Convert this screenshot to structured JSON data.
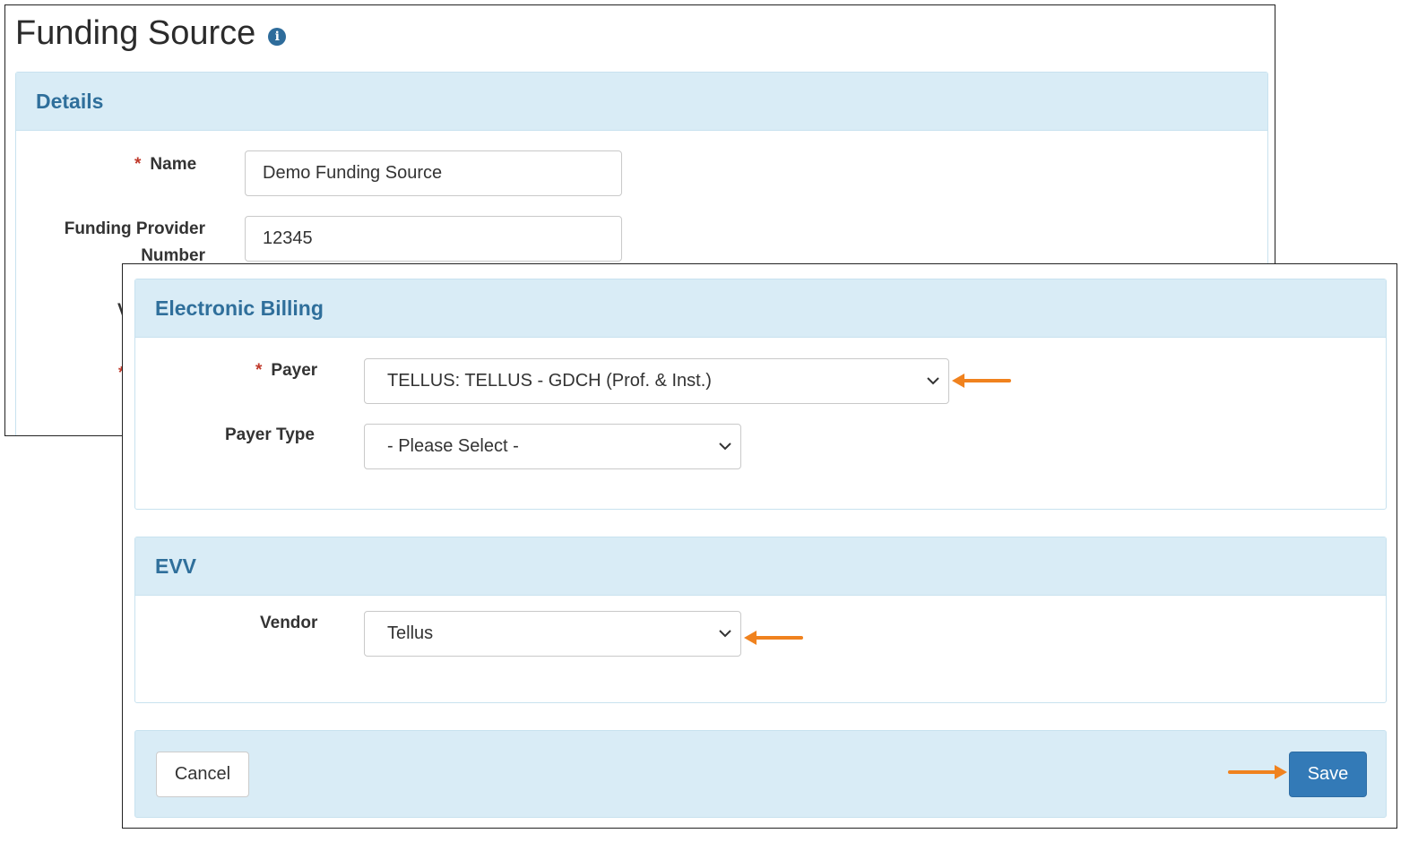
{
  "page": {
    "title": "Funding Source",
    "info_icon": "info-icon"
  },
  "details": {
    "heading": "Details",
    "name_label": "Name",
    "name_required": "*",
    "name_value": "Demo Funding Source",
    "provider_label_line1": "Funding Provider",
    "provider_label_line2": "Number",
    "provider_value": "12345",
    "partial_label_1": "V",
    "partial_required_2": "*"
  },
  "electronic_billing": {
    "heading": "Electronic Billing",
    "payer_label": "Payer",
    "payer_required": "*",
    "payer_selected": "TELLUS: TELLUS - GDCH (Prof. & Inst.)",
    "payer_type_label": "Payer Type",
    "payer_type_selected": "- Please Select -"
  },
  "evv": {
    "heading": "EVV",
    "vendor_label": "Vendor",
    "vendor_selected": "Tellus"
  },
  "footer": {
    "cancel_label": "Cancel",
    "save_label": "Save"
  },
  "colors": {
    "accent": "#337ab7",
    "heading_text": "#2f6f9b",
    "panel_header_bg": "#d9ecf6",
    "required": "#c0392b",
    "annotation_arrow": "#f0821e"
  },
  "icons": {
    "chevron": "chevron-down-icon",
    "arrow_left": "arrow-left-icon",
    "arrow_right": "arrow-right-icon"
  }
}
